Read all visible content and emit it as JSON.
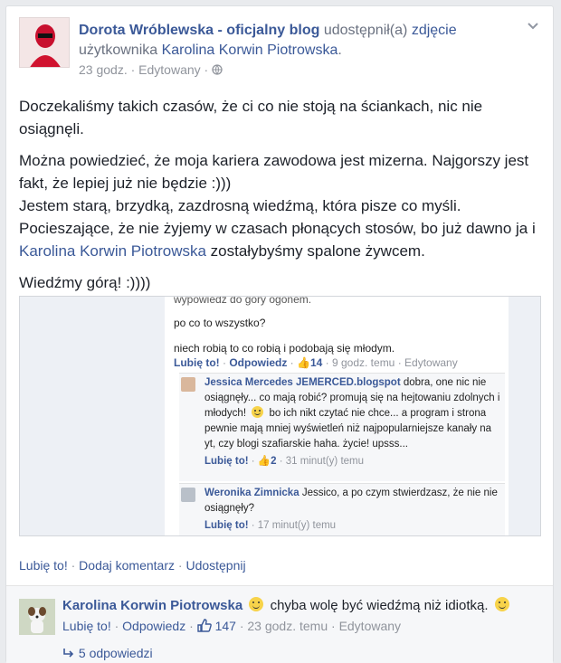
{
  "post": {
    "author": "Dorota Wróblewska - oficjalny blog",
    "shared_text": "udostępnił(a)",
    "object_link": "zdjęcie",
    "of_user_text": "użytkownika",
    "source_user": "Karolina Korwin Piotrowska",
    "period": ".",
    "time": "23 godz.",
    "sep": "·",
    "edited": "Edytowany",
    "audience_icon": "globe-icon",
    "menu_icon": "chevron-down-icon",
    "paragraph_1": "Doczekaliśmy takich czasów, że ci co nie stoją na ściankach, nic nie osiągnęli.",
    "paragraph_2a": "Można powiedzieć, że moja kariera zawodowa jest mizerna. Najgorszy jest fakt, że lepiej już nie będzie :)))",
    "paragraph_2b": "Jestem starą, brzydką, zazdrosną wiedźmą, która pisze co myśli. Pocieszające, że nie żyjemy w czasach płonących stosów, bo już dawno ja i",
    "paragraph_2_link": "Karolina Korwin Piotrowska",
    "paragraph_2c": "zostałybyśmy spalone żywcem.",
    "paragraph_3": "Wiedźmy górą! :))))"
  },
  "screenshot": {
    "top_line": "wypowiedz do góry ogonem.",
    "line_1": "po co to wszystko?",
    "line_2": "niech robią to co robią i podobają się młodym.",
    "c1_like": "Lubię to!",
    "c1_reply": "Odpowiedz",
    "c1_likes": "14",
    "c1_time": "9 godz. temu",
    "c1_edited": "Edytowany",
    "r1_name": "Jessica Mercedes JEMERCED.blogspot",
    "r1_text_a": "dobra, one nic nie osiągnęły... co mają robić? promują się na hejtowaniu zdolnych i młodych!",
    "r1_text_b": "bo ich nikt czytać nie chce... a program i strona pewnie mają mniej wyświetleń niż najpopularniejsze kanały na yt, czy blogi szafiarskie haha. życie! upsss...",
    "r1_like": "Lubię to!",
    "r1_likes": "2",
    "r1_time": "31 minut(y) temu",
    "r2_name": "Weronika Zimnicka",
    "r2_text": "Jessico, a po czym stwierdzasz, że nie nie osiągnęły?",
    "r2_like": "Lubię to!",
    "r2_time": "17 minut(y) temu"
  },
  "actions": {
    "like": "Lubię to!",
    "comment": "Dodaj komentarz",
    "share": "Udostępnij",
    "sep": "·"
  },
  "comment": {
    "author": "Karolina Korwin Piotrowska",
    "text": "chyba wolę być wiedźmą niż idiotką.",
    "like": "Lubię to!",
    "reply": "Odpowiedz",
    "likes": "147",
    "time": "23 godz. temu",
    "edited": "Edytowany",
    "replies": "5 odpowiedzi"
  }
}
